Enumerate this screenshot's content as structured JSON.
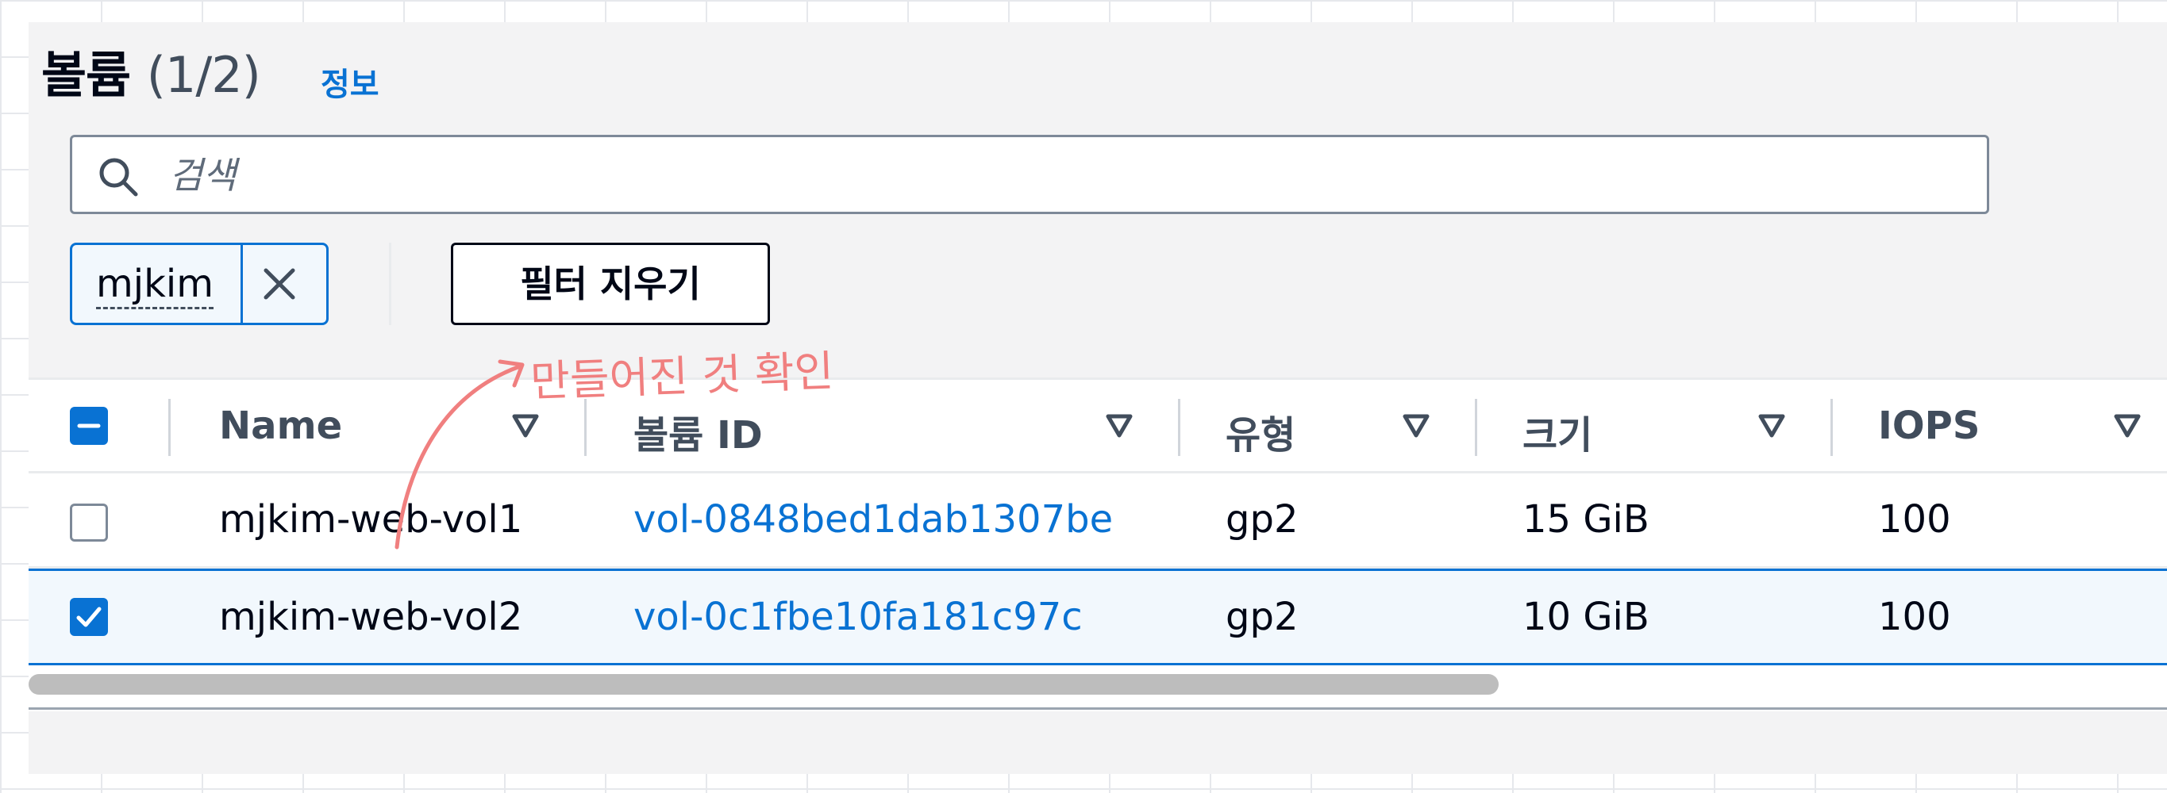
{
  "header": {
    "title": "볼륨",
    "count": "(1/2)",
    "info_link": "정보"
  },
  "search": {
    "placeholder": "검색",
    "value": ""
  },
  "filter": {
    "token_label": "mjkim",
    "clear_label": "필터 지우기"
  },
  "table": {
    "columns": [
      {
        "label": "Name"
      },
      {
        "label": "볼륨 ID"
      },
      {
        "label": "유형"
      },
      {
        "label": "크기"
      },
      {
        "label": "IOPS"
      }
    ],
    "rows": [
      {
        "selected": false,
        "name": "mjkim-web-vol1",
        "volume_id": "vol-0848bed1dab1307be",
        "type": "gp2",
        "size": "15 GiB",
        "iops": "100"
      },
      {
        "selected": true,
        "name": "mjkim-web-vol2",
        "volume_id": "vol-0c1fbe10fa181c97c",
        "type": "gp2",
        "size": "10 GiB",
        "iops": "100"
      }
    ]
  },
  "annotation": {
    "text": "만들어진 것 확인",
    "color": "#f07f7f"
  },
  "colors": {
    "accent": "#0972d3",
    "text": "#000716",
    "border": "#7d8998"
  },
  "icons": {
    "search": "search-icon",
    "close": "close-icon",
    "sort": "sort-caret-icon",
    "select_all": "indeterminate-checkbox-icon",
    "check": "checkmark-icon"
  }
}
